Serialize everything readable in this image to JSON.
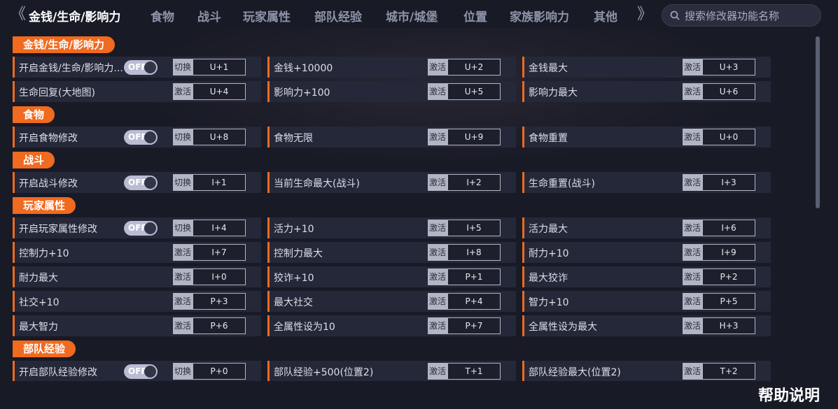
{
  "nav": {
    "tabs": [
      "金钱/生命/影响力",
      "食物",
      "战斗",
      "玩家属性",
      "部队经验",
      "城市/城堡",
      "位置",
      "家族影响力",
      "其他"
    ],
    "active_index": 0,
    "left_arrow": "《",
    "right_arrow": "》"
  },
  "search": {
    "placeholder": "搜索修改器功能名称"
  },
  "help_label": "帮助说明",
  "sections": [
    {
      "title": "金钱/生命/影响力",
      "rows": [
        [
          {
            "label": "开启金钱/生命/影响力...",
            "toggle": "OFF",
            "type": "切换",
            "key": "U+1"
          },
          {
            "label": "金钱+10000",
            "type": "激活",
            "key": "U+2"
          },
          {
            "label": "金钱最大",
            "type": "激活",
            "key": "U+3"
          }
        ],
        [
          {
            "label": "生命回复(大地图)",
            "type": "激活",
            "key": "U+4"
          },
          {
            "label": "影响力+100",
            "type": "激活",
            "key": "U+5"
          },
          {
            "label": "影响力最大",
            "type": "激活",
            "key": "U+6"
          }
        ]
      ]
    },
    {
      "title": "食物",
      "rows": [
        [
          {
            "label": "开启食物修改",
            "toggle": "OFF",
            "type": "切换",
            "key": "U+8"
          },
          {
            "label": "食物无限",
            "type": "激活",
            "key": "U+9"
          },
          {
            "label": "食物重置",
            "type": "激活",
            "key": "U+0"
          }
        ]
      ]
    },
    {
      "title": "战斗",
      "rows": [
        [
          {
            "label": "开启战斗修改",
            "toggle": "OFF",
            "type": "切换",
            "key": "I+1"
          },
          {
            "label": "当前生命最大(战斗)",
            "type": "激活",
            "key": "I+2"
          },
          {
            "label": "生命重置(战斗)",
            "type": "激活",
            "key": "I+3"
          }
        ]
      ]
    },
    {
      "title": "玩家属性",
      "rows": [
        [
          {
            "label": "开启玩家属性修改",
            "toggle": "OFF",
            "type": "切换",
            "key": "I+4"
          },
          {
            "label": "活力+10",
            "type": "激活",
            "key": "I+5"
          },
          {
            "label": "活力最大",
            "type": "激活",
            "key": "I+6"
          }
        ],
        [
          {
            "label": "控制力+10",
            "type": "激活",
            "key": "I+7"
          },
          {
            "label": "控制力最大",
            "type": "激活",
            "key": "I+8"
          },
          {
            "label": "耐力+10",
            "type": "激活",
            "key": "I+9"
          }
        ],
        [
          {
            "label": "耐力最大",
            "type": "激活",
            "key": "I+0"
          },
          {
            "label": "狡诈+10",
            "type": "激活",
            "key": "P+1"
          },
          {
            "label": "最大狡诈",
            "type": "激活",
            "key": "P+2"
          }
        ],
        [
          {
            "label": "社交+10",
            "type": "激活",
            "key": "P+3"
          },
          {
            "label": "最大社交",
            "type": "激活",
            "key": "P+4"
          },
          {
            "label": "智力+10",
            "type": "激活",
            "key": "P+5"
          }
        ],
        [
          {
            "label": "最大智力",
            "type": "激活",
            "key": "P+6"
          },
          {
            "label": "全属性设为10",
            "type": "激活",
            "key": "P+7"
          },
          {
            "label": "全属性设为最大",
            "type": "激活",
            "key": "H+3"
          }
        ]
      ]
    },
    {
      "title": "部队经验",
      "rows": [
        [
          {
            "label": "开启部队经验修改",
            "toggle": "OFF",
            "type": "切换",
            "key": "P+0"
          },
          {
            "label": "部队经验+500(位置2)",
            "type": "激活",
            "key": "T+1"
          },
          {
            "label": "部队经验最大(位置2)",
            "type": "激活",
            "key": "T+2"
          }
        ]
      ]
    }
  ],
  "colors": {
    "accent": "#f06a1f",
    "background": "#181a26",
    "row": "#252838"
  }
}
